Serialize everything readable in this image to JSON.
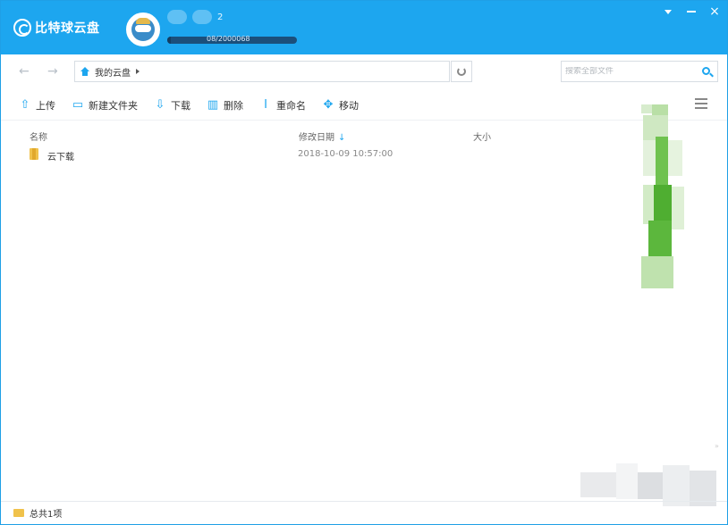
{
  "app": {
    "title": "比特球云盘",
    "user": {
      "name": "2"
    },
    "quota": {
      "text": "08/2000068",
      "used_fraction": 0.03
    }
  },
  "window_controls": {
    "menu": "menu-arrow",
    "minimize": "minimize",
    "close": "×"
  },
  "nav": {
    "back": "←",
    "forward": "→"
  },
  "breadcrumb": {
    "root": "我的云盘"
  },
  "search": {
    "placeholder": "搜索全部文件"
  },
  "toolbar": {
    "upload": "上传",
    "new_folder": "新建文件夹",
    "download": "下载",
    "delete": "删除",
    "rename": "重命名",
    "move": "移动"
  },
  "columns": {
    "name": "名称",
    "modified": "修改日期",
    "size": "大小"
  },
  "files": [
    {
      "name": "云下载",
      "modified": "2018-10-09 10:57:00",
      "size": ""
    }
  ],
  "status": {
    "count": "总共1项"
  },
  "colors": {
    "accent": "#1da6ef",
    "folder": "#f0c24b"
  }
}
